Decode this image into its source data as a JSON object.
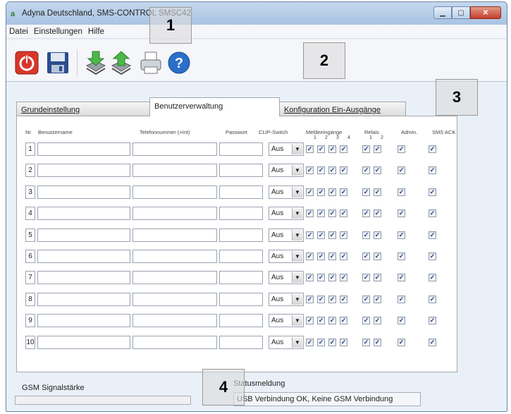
{
  "window": {
    "title": "Adyna Deutschland, SMS-CONTROL SMSC42",
    "app_icon": "a",
    "controls": [
      "minimize-icon",
      "maximize-icon",
      "close-icon"
    ]
  },
  "menu": [
    "Datei",
    "Einstellungen",
    "Hilfe"
  ],
  "toolbar": {
    "icons": [
      "power-icon",
      "save-icon",
      "download-icon",
      "upload-icon",
      "print-icon",
      "help-icon"
    ],
    "help_label": "?"
  },
  "tabs": [
    {
      "label": "Grundeinstellung",
      "active": false
    },
    {
      "label": "Benutzerverwaltung",
      "active": true
    },
    {
      "label": "Konfiguration Ein-Ausgänge",
      "active": false
    }
  ],
  "table": {
    "headers": {
      "nr": "Nr",
      "name": "Benutzername",
      "phone": "Telefonnummer (+Int)",
      "pass": "Passwort",
      "clip": "CLIP-Switch",
      "melde": "Meldeeingänge",
      "relais": "Relais",
      "admin": "Admin.",
      "ack": "SMS ACK"
    },
    "melde_sub": [
      "1",
      "2",
      "3",
      "4"
    ],
    "relais_sub": [
      "1",
      "2"
    ],
    "rows": [
      {
        "nr": "1",
        "clip": "Aus"
      },
      {
        "nr": "2",
        "clip": "Aus"
      },
      {
        "nr": "3",
        "clip": "Aus"
      },
      {
        "nr": "4",
        "clip": "Aus"
      },
      {
        "nr": "5",
        "clip": "Aus"
      },
      {
        "nr": "6",
        "clip": "Aus"
      },
      {
        "nr": "7",
        "clip": "Aus"
      },
      {
        "nr": "8",
        "clip": "Aus"
      },
      {
        "nr": "9",
        "clip": "Aus"
      },
      {
        "nr": "10",
        "clip": "Aus"
      }
    ],
    "checked": "✓"
  },
  "status": {
    "gsm_label": "GSM Signalstärke",
    "gsm_level": 0,
    "meldung_label": "Statusmeldung",
    "meldung_text": "USB Verbindung OK, Keine GSM Verbindung"
  },
  "callouts": [
    "1",
    "2",
    "3",
    "4"
  ]
}
